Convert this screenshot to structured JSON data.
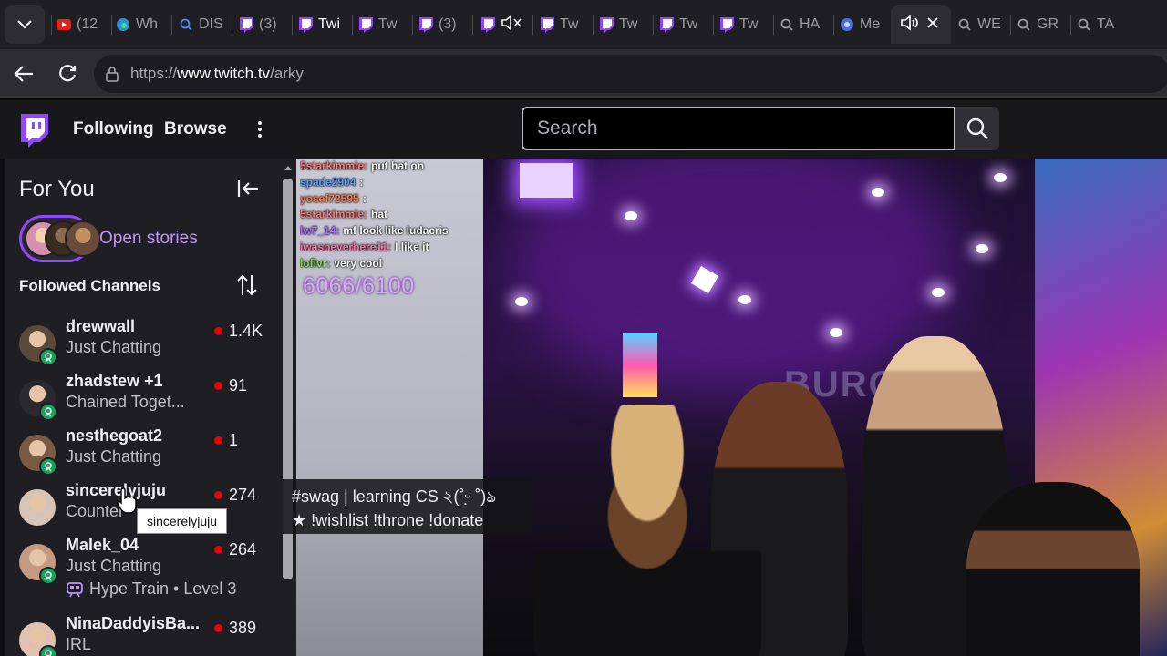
{
  "browser": {
    "tabs": [
      {
        "label": "(12",
        "icon": "youtube-icon",
        "color": "#e62117"
      },
      {
        "label": "Wh",
        "icon": "edge-icon",
        "color": "#2f8fd6"
      },
      {
        "label": "DIS",
        "icon": "search-icon",
        "color": "#4a90ff"
      },
      {
        "label": "(3)",
        "icon": "twitch-icon",
        "color": "#9147ff"
      },
      {
        "label": "Twi",
        "icon": "twitch-icon",
        "color": "#9147ff"
      },
      {
        "label": "Tw",
        "icon": "twitch-icon",
        "color": "#9147ff"
      },
      {
        "label": "(3)",
        "icon": "twitch-icon",
        "color": "#9147ff"
      },
      {
        "label": "",
        "icon": "twitch-icon",
        "color": "#9147ff",
        "muted": true
      },
      {
        "label": "Tw",
        "icon": "twitch-icon",
        "color": "#9147ff"
      },
      {
        "label": "Tw",
        "icon": "twitch-icon",
        "color": "#9147ff"
      },
      {
        "label": "Tw",
        "icon": "twitch-icon",
        "color": "#9147ff"
      },
      {
        "label": "Tw",
        "icon": "twitch-icon",
        "color": "#9147ff"
      },
      {
        "label": "HA",
        "icon": "search-icon",
        "color": "#9a9aa2"
      },
      {
        "label": "Me",
        "icon": "globe-icon",
        "color": "#4a6fd6"
      },
      {
        "label": "WE",
        "icon": "search-icon",
        "color": "#9a9aa2"
      },
      {
        "label": "GR",
        "icon": "search-icon",
        "color": "#9a9aa2"
      },
      {
        "label": "TA",
        "icon": "search-icon",
        "color": "#9a9aa2"
      }
    ],
    "url": {
      "protocol": "https://",
      "host": "www.twitch.tv",
      "path": "/arky"
    }
  },
  "twitch_nav": {
    "following": "Following",
    "browse": "Browse",
    "search_placeholder": "Search",
    "brand_color": "#9147ff"
  },
  "sidebar": {
    "title": "For You",
    "stories_label": "Open stories",
    "section_title": "Followed Channels",
    "channels": [
      {
        "name": "drewwall",
        "category": "Just Chatting",
        "viewers": "1.4K"
      },
      {
        "name": "zhadstew +1",
        "category": "Chained Toget...",
        "viewers": "91"
      },
      {
        "name": "nesthegoat2",
        "category": "Just Chatting",
        "viewers": "1"
      },
      {
        "name": "sincerelyjuju",
        "category": "Counter",
        "viewers": "274"
      },
      {
        "name": "Malek_04",
        "category": "Just Chatting",
        "viewers": "264",
        "extra": "Hype Train • Level 3"
      },
      {
        "name": "NinaDaddyisBa...",
        "category": "IRL",
        "viewers": "389"
      }
    ],
    "tooltip": "sincerelyjuju"
  },
  "stream": {
    "chat": [
      {
        "user": "5starkimmie:",
        "msg": "put hat on",
        "color": "#ff7a7a"
      },
      {
        "user": "spade2904",
        "msg": ":",
        "color": "#5aa0ff"
      },
      {
        "user": "yosef72595",
        "msg": ":",
        "color": "#ff7a4a"
      },
      {
        "user": "5starkimmie:",
        "msg": "hat",
        "color": "#ff7a7a"
      },
      {
        "user": "lw7_14:",
        "msg": "mf look like ludacris",
        "color": "#b06aff"
      },
      {
        "user": "iwasneverhere11:",
        "msg": "I like it",
        "color": "#ff6fae"
      },
      {
        "user": "lofivr:",
        "msg": "very cool",
        "color": "#7ed957"
      }
    ],
    "goal": "6066/6100",
    "title_line1": "#swag | learning CS ২(˚ᵕ̣̣̣̣̣̣ ˚)ঌ",
    "title_line2": "★ !wishlist !throne !donate",
    "sign": "BURGE"
  }
}
